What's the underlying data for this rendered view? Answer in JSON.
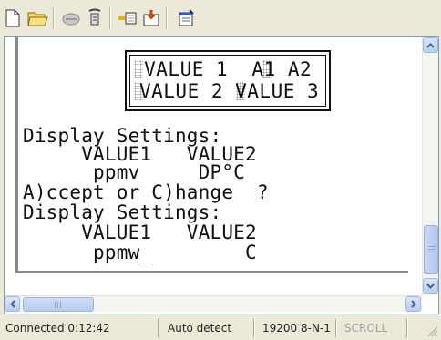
{
  "toolbar": {
    "buttons": [
      {
        "name": "new-icon"
      },
      {
        "name": "open-icon"
      },
      {
        "name": "disconnect-icon"
      },
      {
        "name": "properties-phone-icon"
      },
      {
        "name": "send-icon"
      },
      {
        "name": "receive-icon"
      },
      {
        "name": "properties-icon"
      }
    ]
  },
  "screen": {
    "lcd_line1": " VALUE 1  A1 A2",
    "lcd_line2": "VALUE 2 VALUE 3",
    "lines": [
      "Display Settings:",
      "     VALUE1   VALUE2",
      "      ppmv     DP°C",
      "A)ccept or C)hange  ?",
      "Display Settings:",
      "     VALUE1   VALUE2",
      "      ppmw_        C"
    ]
  },
  "status": {
    "connected": "Connected 0:12:42",
    "detect": "Auto detect",
    "port": "19200 8-N-1",
    "scroll": "SCROLL"
  },
  "colors": {
    "accent": "#b7cdf3",
    "scroll_disabled_text": "#a0a0a0"
  }
}
